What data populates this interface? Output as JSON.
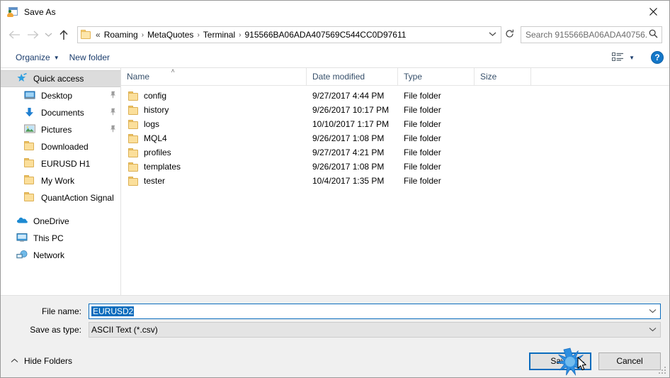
{
  "window": {
    "title": "Save As",
    "icon": "save-as-icon",
    "close_label": "✕"
  },
  "nav": {
    "back_icon": "back-arrow-icon",
    "forward_icon": "forward-arrow-icon",
    "recent_icon": "recent-locations-chevron-icon",
    "up_icon": "up-arrow-icon",
    "folder_icon": "folder-icon",
    "breadcrumb_overflow": "«",
    "breadcrumbs": [
      "Roaming",
      "MetaQuotes",
      "Terminal",
      "915566BA06ADA407569C544CC0D97611"
    ],
    "separator": "›",
    "dropdown_icon": "chevron-down-icon",
    "refresh_icon": "refresh-icon"
  },
  "search": {
    "placeholder": "Search 915566BA06ADA40756...",
    "icon": "search-icon"
  },
  "commandbar": {
    "organize_label": "Organize",
    "organize_caret": "▼",
    "new_folder_label": "New folder",
    "view_icon": "list-view-icon",
    "view_caret": "▼",
    "help_label": "?"
  },
  "sidebar": {
    "items": [
      {
        "label": "Quick access",
        "icon": "star-pin-icon",
        "selected": true,
        "indent": false,
        "pinned": false
      },
      {
        "label": "Desktop",
        "icon": "desktop-icon",
        "selected": false,
        "indent": true,
        "pinned": true
      },
      {
        "label": "Documents",
        "icon": "documents-icon",
        "selected": false,
        "indent": true,
        "pinned": true
      },
      {
        "label": "Pictures",
        "icon": "pictures-icon",
        "selected": false,
        "indent": true,
        "pinned": true
      },
      {
        "label": "Downloaded",
        "icon": "folder-icon",
        "selected": false,
        "indent": true,
        "pinned": false
      },
      {
        "label": "EURUSD H1",
        "icon": "folder-icon",
        "selected": false,
        "indent": true,
        "pinned": false
      },
      {
        "label": "My Work",
        "icon": "folder-icon",
        "selected": false,
        "indent": true,
        "pinned": false
      },
      {
        "label": "QuantAction Signal",
        "icon": "folder-icon",
        "selected": false,
        "indent": true,
        "pinned": false
      },
      {
        "label": "OneDrive",
        "icon": "onedrive-cloud-icon",
        "selected": false,
        "indent": false,
        "pinned": false
      },
      {
        "label": "This PC",
        "icon": "this-pc-icon",
        "selected": false,
        "indent": false,
        "pinned": false
      },
      {
        "label": "Network",
        "icon": "network-icon",
        "selected": false,
        "indent": false,
        "pinned": false
      }
    ],
    "pin_glyph": "📌"
  },
  "filelist": {
    "columns": [
      {
        "key": "name",
        "label": "Name",
        "sorted": true,
        "sort_caret": "˄"
      },
      {
        "key": "date",
        "label": "Date modified",
        "sorted": false
      },
      {
        "key": "type",
        "label": "Type",
        "sorted": false
      },
      {
        "key": "size",
        "label": "Size",
        "sorted": false
      }
    ],
    "rows": [
      {
        "name": "config",
        "date": "9/27/2017 4:44 PM",
        "type": "File folder",
        "size": "",
        "icon": "folder-icon"
      },
      {
        "name": "history",
        "date": "9/26/2017 10:17 PM",
        "type": "File folder",
        "size": "",
        "icon": "folder-icon"
      },
      {
        "name": "logs",
        "date": "10/10/2017 1:17 PM",
        "type": "File folder",
        "size": "",
        "icon": "folder-icon"
      },
      {
        "name": "MQL4",
        "date": "9/26/2017 1:08 PM",
        "type": "File folder",
        "size": "",
        "icon": "folder-icon"
      },
      {
        "name": "profiles",
        "date": "9/27/2017 4:21 PM",
        "type": "File folder",
        "size": "",
        "icon": "folder-icon"
      },
      {
        "name": "templates",
        "date": "9/26/2017 1:08 PM",
        "type": "File folder",
        "size": "",
        "icon": "folder-icon"
      },
      {
        "name": "tester",
        "date": "10/4/2017 1:35 PM",
        "type": "File folder",
        "size": "",
        "icon": "folder-icon"
      }
    ]
  },
  "form": {
    "filename_label": "File name:",
    "filename_value": "EURUSD2",
    "filetype_label": "Save as type:",
    "filetype_value": "ASCII Text (*.csv)",
    "chevron": "∨"
  },
  "footer": {
    "hide_folders_label": "Hide Folders",
    "hide_folders_caret": "˄",
    "save_label": "Save",
    "cancel_label": "Cancel",
    "resize_grip_icon": "resize-grip-icon",
    "cursor_icon": "mouse-cursor-icon",
    "click_burst_icon": "click-burst-icon"
  },
  "colors": {
    "accent": "#0a6cbd",
    "command_text": "#1b3d6d",
    "column_header_text": "#37506b",
    "selection_bg": "#dcdcdc",
    "footer_bg": "#f0f0f0",
    "folder_yellow": "#fbdf9b"
  }
}
